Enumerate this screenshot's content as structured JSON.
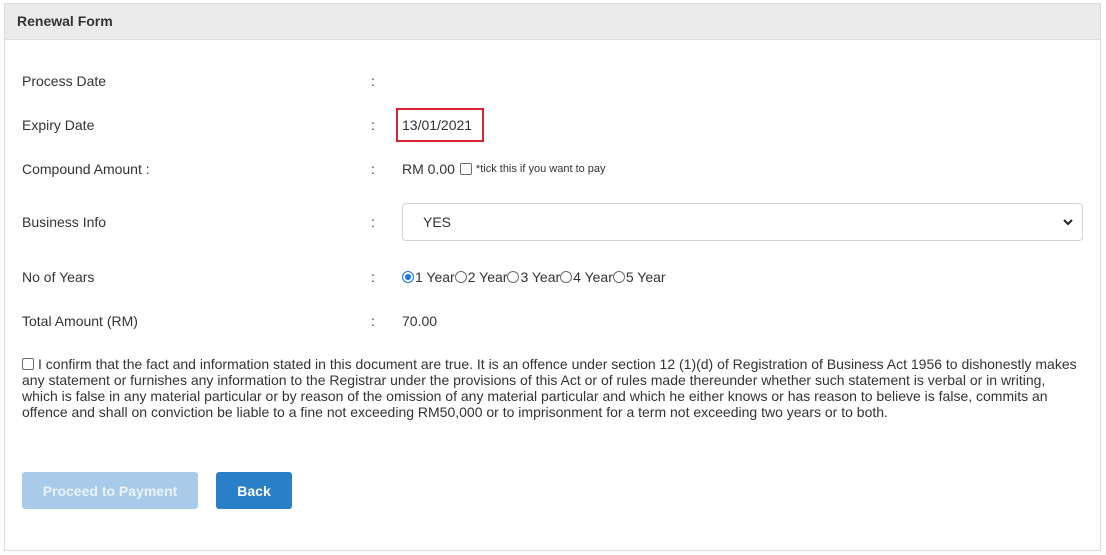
{
  "form": {
    "title": "Renewal Form",
    "colon": ":",
    "process_date": {
      "label": "Process Date",
      "value": ""
    },
    "expiry_date": {
      "label": "Expiry Date",
      "value": "13/01/2021"
    },
    "compound": {
      "label": "Compound Amount :",
      "value": "RM 0.00",
      "hint": "*tick this if you want to pay",
      "checked": false
    },
    "business_info": {
      "label": "Business Info",
      "selected": "YES"
    },
    "years": {
      "label": "No of Years",
      "options": [
        "1 Year",
        "2 Year",
        "3 Year",
        "4 Year",
        "5 Year"
      ],
      "selected": "1 Year"
    },
    "total": {
      "label": "Total Amount (RM)",
      "value": "70.00"
    },
    "declaration": "I confirm that the fact and information stated in this document are true. It is an offence under section 12 (1)(d) of Registration of Business Act 1956 to dishonestly makes any statement or furnishes any information to the Registrar under the provisions of this Act or of rules made thereunder whether such statement is verbal or in writing, which is false in any material particular or by reason of the omission of any material particular and which he either knows or has reason to believe is false, commits an offence and shall on conviction be liable to a fine not exceeding RM50,000 or to imprisonment for a term not exceeding two years or to both.",
    "buttons": {
      "proceed": "Proceed to Payment",
      "back": "Back"
    }
  },
  "colors": {
    "highlight_border": "#d9232d",
    "primary_button": "#2a7fc9",
    "disabled_button": "#a7cbe8",
    "radio_accent": "#1a73e8"
  }
}
